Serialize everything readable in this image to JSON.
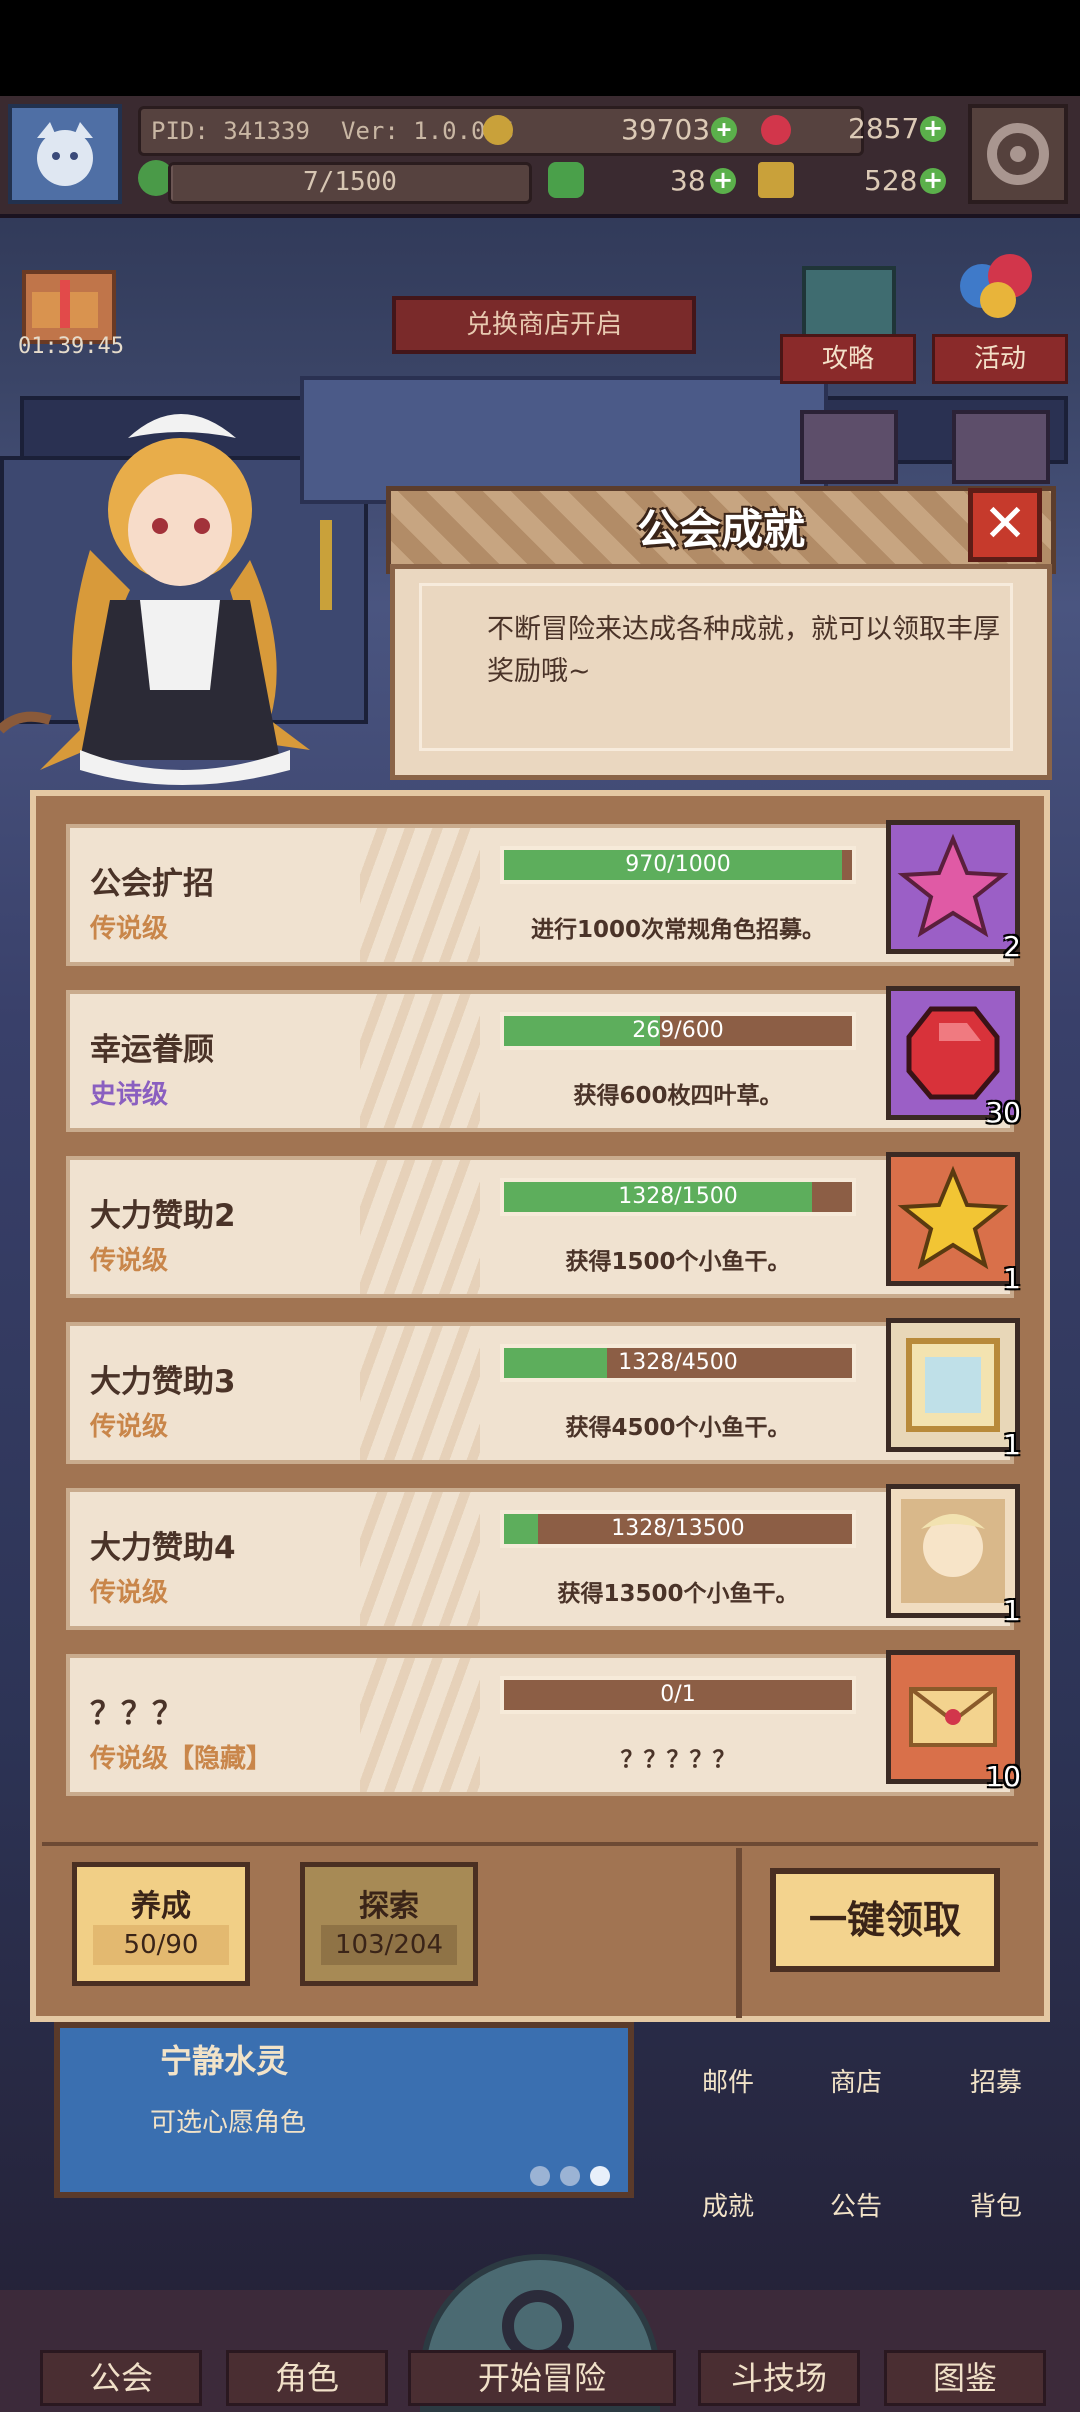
{
  "hud": {
    "pid": "PID: 341339",
    "version": "Ver: 1.0.0.5",
    "gold": "39703",
    "gems": "2857",
    "exp_progress": "7/1500",
    "exp_fraction": 0.0047,
    "clover": "38",
    "fish": "528"
  },
  "side": {
    "gift_timer": "01:39:45",
    "exchange_banner": "兑换商店开启",
    "guide_label": "攻略",
    "event_label": "活动"
  },
  "dialog": {
    "title": "公会成就",
    "description": "不断冒险来达成各种成就，就可以领取丰厚奖励哦~"
  },
  "achievements": [
    {
      "name": "公会扩招",
      "rank": "传说级",
      "rank_color": "#c9864a",
      "progress": "970/1000",
      "fraction": 0.97,
      "desc": "进行1000次常规角色招募。",
      "reward_icon": "pink-star-icon",
      "reward_count": "2",
      "reward_bg": "#9b5fc6"
    },
    {
      "name": "幸运眷顾",
      "rank": "史诗级",
      "rank_color": "#8a5fc0",
      "progress": "269/600",
      "fraction": 0.448,
      "desc": "获得600枚四叶草。",
      "reward_icon": "red-gem-icon",
      "reward_count": "30",
      "reward_bg": "#9b5fc6"
    },
    {
      "name": "大力赞助2",
      "rank": "传说级",
      "rank_color": "#c9864a",
      "progress": "1328/1500",
      "fraction": 0.885,
      "desc": "获得1500个小鱼干。",
      "reward_icon": "gold-star-icon",
      "reward_count": "1",
      "reward_bg": "#d9704a"
    },
    {
      "name": "大力赞助3",
      "rank": "传说级",
      "rank_color": "#c9864a",
      "progress": "1328/4500",
      "fraction": 0.295,
      "desc": "获得4500个小鱼干。",
      "reward_icon": "picture-frame-icon",
      "reward_count": "1",
      "reward_bg": "#e8d7b8"
    },
    {
      "name": "大力赞助4",
      "rank": "传说级",
      "rank_color": "#c9864a",
      "progress": "1328/13500",
      "fraction": 0.098,
      "desc": "获得13500个小鱼干。",
      "reward_icon": "character-portrait-icon",
      "reward_count": "1",
      "reward_bg": "#f0dcc0"
    },
    {
      "name": "？？？",
      "rank": "传说级【隐藏】",
      "rank_color": "#c9864a",
      "progress": "0/1",
      "fraction": 0,
      "desc": "？？？？？",
      "reward_icon": "envelope-icon",
      "reward_count": "10",
      "reward_bg": "#d9704a"
    }
  ],
  "tabs": [
    {
      "label": "养成",
      "value": "50/90"
    },
    {
      "label": "探索",
      "value": "103/204"
    }
  ],
  "claim_all": "一键领取",
  "background": {
    "banner_title": "宁静水灵",
    "banner_sub": "可选心愿角色",
    "side_buttons": [
      "邮件",
      "商店",
      "招募",
      "成就",
      "公告",
      "背包"
    ]
  },
  "nav": [
    "公会",
    "角色",
    "开始冒险",
    "斗技场",
    "图鉴"
  ]
}
